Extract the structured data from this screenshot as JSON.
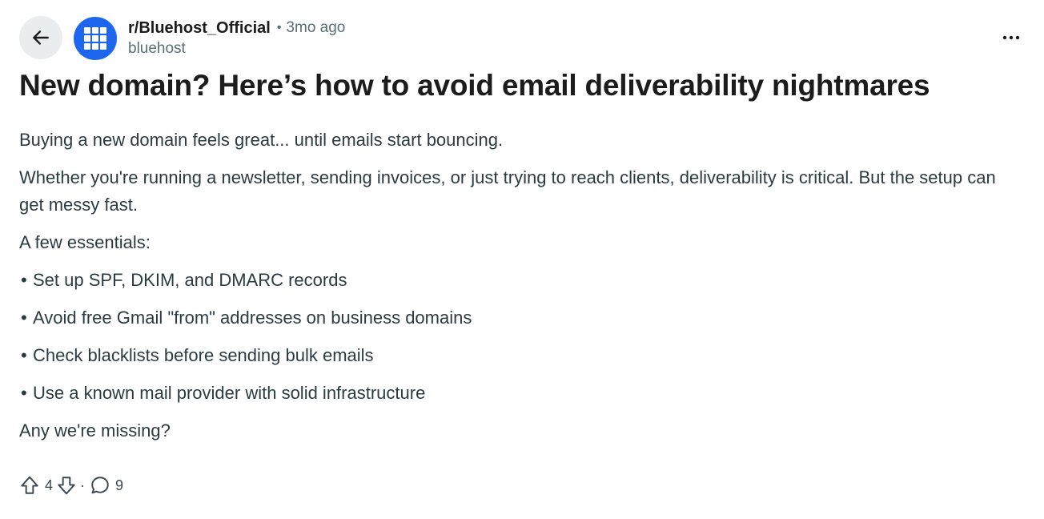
{
  "post": {
    "subreddit": "r/Bluehost_Official",
    "separator": "•",
    "time_ago": "3mo ago",
    "author": "bluehost",
    "title": "New domain? Here’s how to avoid email deliverability nightmares",
    "paragraphs": [
      "Buying a new domain feels great... until emails start bouncing.",
      "Whether you're running a newsletter, sending invoices, or just trying to reach clients, deliverability is critical. But the setup can get messy fast.",
      "A few essentials:"
    ],
    "bullet_char": "•",
    "bullets": [
      "Set up SPF, DKIM, and DMARC records",
      "Avoid free Gmail \"from\" addresses on business domains",
      "Check blacklists before sending bulk emails",
      "Use a known mail provider with solid infrastructure"
    ],
    "closing": "Any we're missing?"
  },
  "footer": {
    "upvotes": "4",
    "separator": "·",
    "comments": "9"
  },
  "icons": {
    "back": "arrow-left-icon",
    "avatar": "grid-logo-icon",
    "more": "more-horizontal-icon",
    "upvote": "upvote-arrow-icon",
    "downvote": "downvote-arrow-icon",
    "comment": "comment-bubble-icon"
  },
  "colors": {
    "brand": "#1f66ee",
    "back_button_bg": "#eaedef",
    "text": "#1c1c1c",
    "meta": "#576f76"
  }
}
